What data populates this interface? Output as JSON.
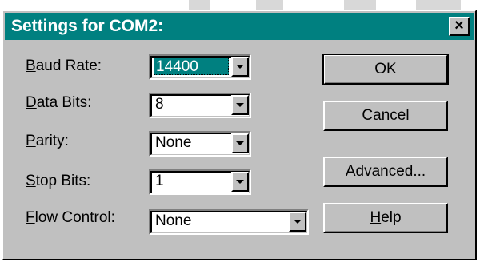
{
  "window": {
    "title": "Settings for COM2:",
    "close_glyph": "×"
  },
  "fields": [
    {
      "label_u": "B",
      "label_rest": "aud Rate:",
      "value": "14400"
    },
    {
      "label_u": "D",
      "label_rest": "ata Bits:",
      "value": "8"
    },
    {
      "label_u": "P",
      "label_rest": "arity:",
      "value": "None"
    },
    {
      "label_u": "S",
      "label_rest": "top Bits:",
      "value": "1"
    },
    {
      "label_u": "F",
      "label_rest": "low Control:",
      "value": "None"
    }
  ],
  "buttons": {
    "ok": "OK",
    "cancel": "Cancel",
    "advanced_u": "A",
    "advanced_rest": "dvanced...",
    "help_u": "H",
    "help_rest": "elp"
  },
  "colors": {
    "titlebar": "#008080",
    "face": "#c0c0c0"
  }
}
